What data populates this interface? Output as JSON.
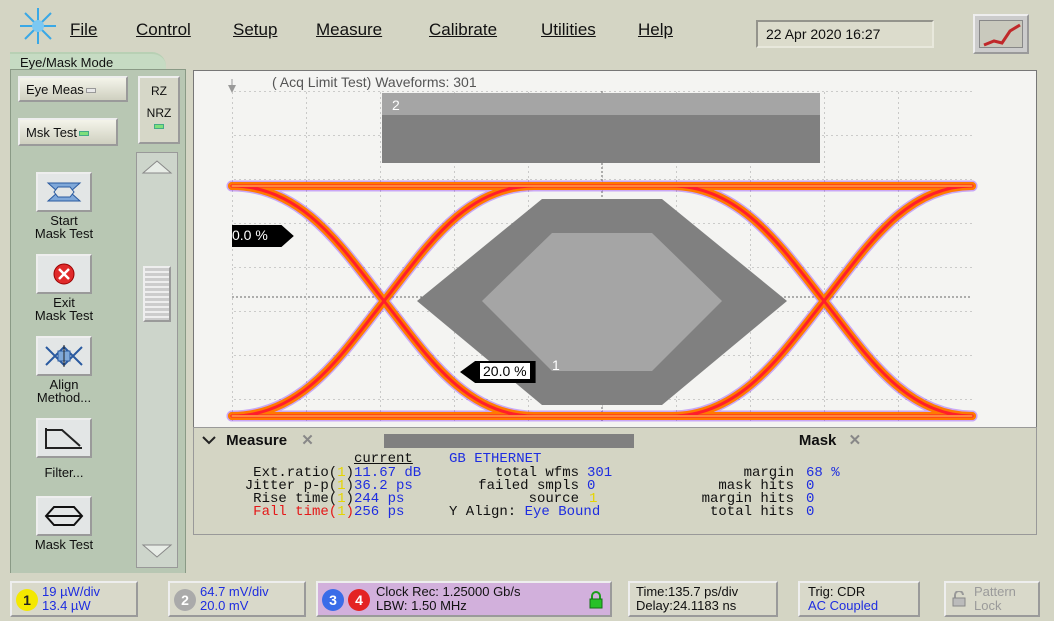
{
  "menubar": {
    "items": [
      "File",
      "Control",
      "Setup",
      "Measure",
      "Calibrate",
      "Utilities",
      "Help"
    ],
    "datetime": "22 Apr 2020   16:27",
    "logo_icon": "starburst-icon",
    "scope_button_icon": "scope-waveform-icon"
  },
  "mode_tab": "Eye/Mask Mode",
  "left_panel": {
    "eye_meas": "Eye Meas",
    "msk_test": "Msk Test",
    "rz": "RZ",
    "nrz": "NRZ",
    "tools": [
      {
        "label": "Start\nMask Test",
        "icon": "start-mask-icon"
      },
      {
        "label": "Exit\nMask Test",
        "icon": "exit-mask-icon"
      },
      {
        "label": "Align\nMethod...",
        "icon": "align-method-icon"
      },
      {
        "label": "Filter...",
        "icon": "filter-icon"
      },
      {
        "label": "Mask Test",
        "icon": "mask-test-icon"
      }
    ]
  },
  "screen": {
    "acq_header": "( Acq Limit Test)  Waveforms: 301",
    "marker_top": "0.0 %",
    "marker_bottom": "20.0 %",
    "mask_label_2": "2",
    "mask_label_1": "1",
    "colors": {
      "eye_outer": "#ff7a00",
      "eye_inner": "#ff1e2c",
      "eye_noise": "#7a1aff",
      "mask": "#808080",
      "mask_inner": "#a5a5a5"
    }
  },
  "measure": {
    "tab_label": "Measure",
    "mask_tab_label": "Mask",
    "column_header": "current",
    "rows": [
      {
        "name": "Ext.ratio(",
        "ch": "1",
        "value": "11.67 dB"
      },
      {
        "name": "Jitter p-p(",
        "ch": "1",
        "value": "36.2 ps"
      },
      {
        "name": "Rise time(",
        "ch": "1",
        "value": "244 ps"
      },
      {
        "name": "Fall time(",
        "ch": "1",
        "value": "256 ps"
      }
    ],
    "mask": {
      "standard": "GB ETHERNET",
      "total_wfms_label": "total wfms",
      "total_wfms": "301",
      "failed_smpls_label": "failed smpls",
      "failed_smpls": "0",
      "source_label": "source",
      "source": "1",
      "yalign_label": "Y Align:",
      "yalign": "Eye Bound",
      "margin_label": "margin",
      "margin": "68 %",
      "mask_hits_label": "mask hits",
      "mask_hits": "0",
      "margin_hits_label": "margin hits",
      "margin_hits": "0",
      "total_hits_label": "total hits",
      "total_hits": "0"
    }
  },
  "statusbar": {
    "ch1_num": "1",
    "ch1_line1": "19 µW/div",
    "ch1_line2": "13.4 µW",
    "ch2_num": "2",
    "ch2_line1": "64.7 mV/div",
    "ch2_line2": "20.0 mV",
    "ch3_num": "3",
    "ch4_num": "4",
    "clock_line1": "Clock Rec: 1.25000 Gb/s",
    "clock_line2": "LBW: 1.50 MHz",
    "time_line1": "Time:135.7 ps/div",
    "time_line2": "Delay:24.1183 ns",
    "trig_line1": "Trig: CDR",
    "trig_line2": "AC Coupled",
    "pattern_line1": "Pattern",
    "pattern_line2": "Lock"
  }
}
